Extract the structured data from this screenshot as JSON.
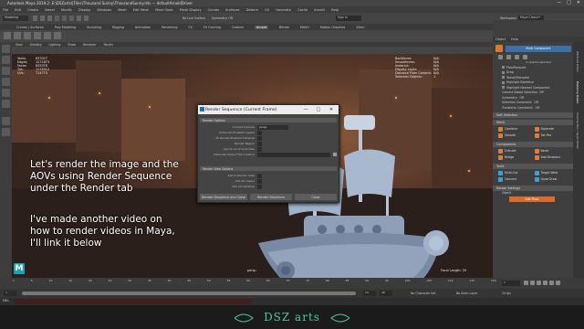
{
  "window": {
    "title": "Autodesk Maya 2019.2: E:\\DSZarts\\[Files\\Thousand Sunny\\ThousandSunny.mb  ---  defaultArnoldDriver",
    "controls": [
      "—",
      "□",
      "✕"
    ]
  },
  "menubar": [
    "File",
    "Edit",
    "Create",
    "Select",
    "Modify",
    "Display",
    "Windows",
    "Mesh",
    "Edit Mesh",
    "Mesh Tools",
    "Mesh Display",
    "Curves",
    "Surfaces",
    "Deform",
    "UV",
    "Generate",
    "Cache",
    "Arnold",
    "Help"
  ],
  "statusline": {
    "mode": "Modeling",
    "symmetry": "Symmetry: Off",
    "surface": "No Live Surface",
    "sign_in": "Sign In",
    "workspace_label": "Workspace:",
    "workspace_value": "Maya Classic*"
  },
  "shelf_tabs": [
    "Curves / Surfaces",
    "Poly Modeling",
    "Sculpting",
    "Rigging",
    "Animation",
    "Rendering",
    "FX",
    "FX Caching",
    "Custom",
    "Arnold",
    "Bifrost",
    "MASH",
    "Motion Graphics",
    "XGen"
  ],
  "shelf_active": "Arnold",
  "viewport": {
    "panel_menu": [
      "View",
      "Shading",
      "Lighting",
      "Show",
      "Renderer",
      "Panels"
    ],
    "hud_left": [
      {
        "k": "Verts:",
        "v": "637027"
      },
      {
        "k": "Edges:",
        "v": "1271873"
      },
      {
        "k": "Faces:",
        "v": "635376"
      },
      {
        "k": "Tris:",
        "v": "1174512"
      },
      {
        "k": "UVs:",
        "v": "714773"
      }
    ],
    "hud_right": [
      {
        "k": "Backfaces:",
        "v": "N/A"
      },
      {
        "k": "Smoothness:",
        "v": "N/A"
      },
      {
        "k": "Instance:",
        "v": "N/A"
      },
      {
        "k": "Display Layer:",
        "v": "N/A"
      },
      {
        "k": "Distance From Camera:",
        "v": "N/A"
      },
      {
        "k": "Selected Objects:",
        "v": "1"
      }
    ],
    "camera_label": "persp",
    "focal_label": "Focal Length:",
    "focal_value": "35"
  },
  "overlay": {
    "para1": [
      "Let's render the image and the",
      "AOVs using Render Sequence",
      "under the Render tab"
    ],
    "para2": [
      "I've made another video on",
      "how to render videos in Maya,",
      "I'll link it below"
    ]
  },
  "dialog": {
    "title": "Render Sequence (Current Frame)",
    "section1": "Render Options",
    "fields": [
      {
        "label": "Current Camera",
        "value": "persp"
      },
      {
        "label": "All Render-Enabled Layers",
        "value": ""
      },
      {
        "label": "All Render-Enabled Cameras",
        "value": ""
      },
      {
        "label": "Render Region",
        "value": ""
      },
      {
        "label": "Ignore Local Overrides",
        "value": ""
      },
      {
        "label": "Alternate Output File Location",
        "value": ""
      }
    ],
    "section2": "Render View Options",
    "view_fields": [
      "Add to Render View",
      "Add All Layers",
      "Add All Cameras"
    ],
    "buttons": [
      "Render Sequence and Close",
      "Render Sequence",
      "Close"
    ]
  },
  "attr_panel": {
    "tabs": [
      "Object",
      "Help"
    ],
    "multi_component": "Multi Component",
    "counts": "0 objects selected",
    "options": [
      "Pick/Marquee",
      "Drag",
      "Tweak/Marquee",
      "Highlight Backface",
      "Highlight Nearest Component"
    ],
    "camera_select": "Camera Based Selection",
    "camera_select_value": "Off",
    "symmetry_label": "Symmetry:",
    "symmetry_value": "Off",
    "selection_constraint": "Selection Constraint:",
    "selection_constraint_value": "Off",
    "transform_constraint": "Transform Constraint:",
    "transform_constraint_value": "Off",
    "soft_selection": "Soft Selection",
    "mesh_header": "Mesh",
    "mesh_buttons": [
      {
        "label": "Combine",
        "color": "#e07b39"
      },
      {
        "label": "Separate",
        "color": "#e07b39"
      },
      {
        "label": "Smooth",
        "color": "#e07b39"
      },
      {
        "label": "Set Pos",
        "color": "#e07b39"
      }
    ],
    "components_header": "Components",
    "component_buttons": [
      {
        "label": "Extrude",
        "color": "#e07b39"
      },
      {
        "label": "Bevel",
        "color": "#e07b39"
      },
      {
        "label": "Bridge",
        "color": "#e07b39"
      },
      {
        "label": "Add Divisions",
        "color": "#e07b39"
      }
    ],
    "tools_header": "Tools",
    "tool_buttons": [
      {
        "label": "Multi-Cut",
        "color": "#3aa0d8"
      },
      {
        "label": "Target Weld",
        "color": "#3aa0d8"
      },
      {
        "label": "Connect",
        "color": "#3aa0d8"
      },
      {
        "label": "Quad Draw",
        "color": "#3aa0d8"
      }
    ],
    "rotate_settings": "Rotate Settings",
    "object_label": "Object",
    "edit_pivot": "Edit Pivot"
  },
  "sidebar_tabs": [
    "Attribute Editor",
    "Modeling Toolkit",
    "Channel Box / Layer Editor"
  ],
  "timeline": {
    "ticks": [
      "1",
      "5",
      "10",
      "15",
      "20",
      "25",
      "30",
      "35",
      "40",
      "45",
      "50",
      "55",
      "60",
      "65",
      "70",
      "75",
      "80",
      "85",
      "90",
      "95",
      "100",
      "105",
      "110",
      "115",
      "120"
    ],
    "start": "1",
    "range_start": "1",
    "range_end": "24",
    "end": "48",
    "char_set": "No Character Set",
    "anim_layer": "No Anim Layer",
    "fps": "24 fps"
  },
  "cmdline": {
    "label": "MEL"
  },
  "footer": {
    "brand": "DSZ arts"
  }
}
